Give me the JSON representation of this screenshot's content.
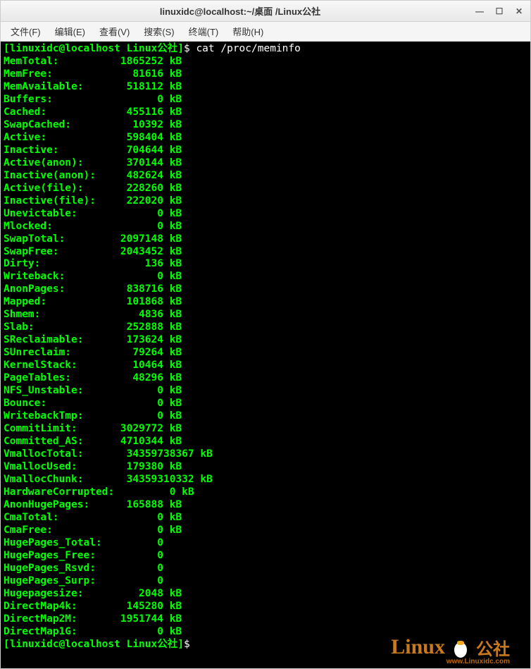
{
  "window": {
    "title": "linuxidc@localhost:~/桌面 /Linux公社"
  },
  "menu": {
    "file": "文件(F)",
    "edit": "编辑(E)",
    "view": "查看(V)",
    "search": "搜索(S)",
    "terminal": "终端(T)",
    "help": "帮助(H)"
  },
  "prompt": {
    "prefix": "[linuxidc@localhost Linux公社]",
    "dollar": "$",
    "command": "cat /proc/meminfo"
  },
  "meminfo": [
    {
      "key": "MemTotal:",
      "val": "1865252",
      "unit": "kB"
    },
    {
      "key": "MemFree:",
      "val": "81616",
      "unit": "kB"
    },
    {
      "key": "MemAvailable:",
      "val": "518112",
      "unit": "kB"
    },
    {
      "key": "Buffers:",
      "val": "0",
      "unit": "kB"
    },
    {
      "key": "Cached:",
      "val": "455116",
      "unit": "kB"
    },
    {
      "key": "SwapCached:",
      "val": "10392",
      "unit": "kB"
    },
    {
      "key": "Active:",
      "val": "598404",
      "unit": "kB"
    },
    {
      "key": "Inactive:",
      "val": "704644",
      "unit": "kB"
    },
    {
      "key": "Active(anon):",
      "val": "370144",
      "unit": "kB"
    },
    {
      "key": "Inactive(anon):",
      "val": "482624",
      "unit": "kB"
    },
    {
      "key": "Active(file):",
      "val": "228260",
      "unit": "kB"
    },
    {
      "key": "Inactive(file):",
      "val": "222020",
      "unit": "kB"
    },
    {
      "key": "Unevictable:",
      "val": "0",
      "unit": "kB"
    },
    {
      "key": "Mlocked:",
      "val": "0",
      "unit": "kB"
    },
    {
      "key": "SwapTotal:",
      "val": "2097148",
      "unit": "kB"
    },
    {
      "key": "SwapFree:",
      "val": "2043452",
      "unit": "kB"
    },
    {
      "key": "Dirty:",
      "val": "136",
      "unit": "kB"
    },
    {
      "key": "Writeback:",
      "val": "0",
      "unit": "kB"
    },
    {
      "key": "AnonPages:",
      "val": "838716",
      "unit": "kB"
    },
    {
      "key": "Mapped:",
      "val": "101868",
      "unit": "kB"
    },
    {
      "key": "Shmem:",
      "val": "4836",
      "unit": "kB"
    },
    {
      "key": "Slab:",
      "val": "252888",
      "unit": "kB"
    },
    {
      "key": "SReclaimable:",
      "val": "173624",
      "unit": "kB"
    },
    {
      "key": "SUnreclaim:",
      "val": "79264",
      "unit": "kB"
    },
    {
      "key": "KernelStack:",
      "val": "10464",
      "unit": "kB"
    },
    {
      "key": "PageTables:",
      "val": "48296",
      "unit": "kB"
    },
    {
      "key": "NFS_Unstable:",
      "val": "0",
      "unit": "kB"
    },
    {
      "key": "Bounce:",
      "val": "0",
      "unit": "kB"
    },
    {
      "key": "WritebackTmp:",
      "val": "0",
      "unit": "kB"
    },
    {
      "key": "CommitLimit:",
      "val": "3029772",
      "unit": "kB"
    },
    {
      "key": "Committed_AS:",
      "val": "4710344",
      "unit": "kB"
    },
    {
      "key": "VmallocTotal:",
      "val": "34359738367",
      "unit": "kB"
    },
    {
      "key": "VmallocUsed:",
      "val": "179380",
      "unit": "kB"
    },
    {
      "key": "VmallocChunk:",
      "val": "34359310332",
      "unit": "kB"
    },
    {
      "key": "HardwareCorrupted:",
      "val": "0",
      "unit": "kB"
    },
    {
      "key": "AnonHugePages:",
      "val": "165888",
      "unit": "kB"
    },
    {
      "key": "CmaTotal:",
      "val": "0",
      "unit": "kB"
    },
    {
      "key": "CmaFree:",
      "val": "0",
      "unit": "kB"
    },
    {
      "key": "HugePages_Total:",
      "val": "0",
      "unit": ""
    },
    {
      "key": "HugePages_Free:",
      "val": "0",
      "unit": ""
    },
    {
      "key": "HugePages_Rsvd:",
      "val": "0",
      "unit": ""
    },
    {
      "key": "HugePages_Surp:",
      "val": "0",
      "unit": ""
    },
    {
      "key": "Hugepagesize:",
      "val": "2048",
      "unit": "kB"
    },
    {
      "key": "DirectMap4k:",
      "val": "145280",
      "unit": "kB"
    },
    {
      "key": "DirectMap2M:",
      "val": "1951744",
      "unit": "kB"
    },
    {
      "key": "DirectMap1G:",
      "val": "0",
      "unit": "kB"
    }
  ],
  "fieldwidth": {
    "key": 16,
    "val": 12,
    "val_long": 15
  },
  "watermark": {
    "brand": "Linux",
    "suffix": "公社",
    "url": "www.Linuxidc.com"
  }
}
